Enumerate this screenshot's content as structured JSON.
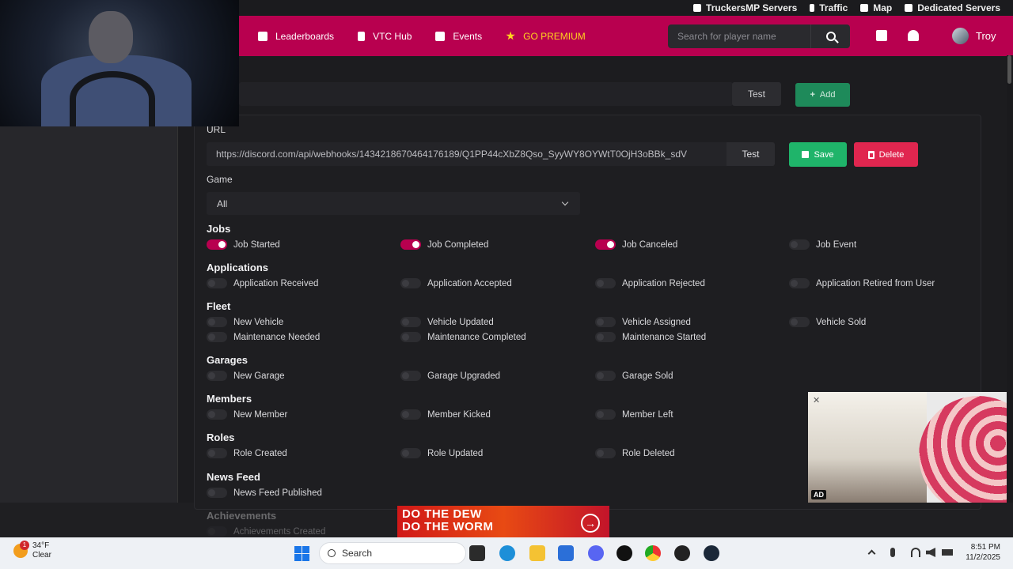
{
  "topbar": {
    "links": [
      "TruckersMP Servers",
      "Traffic",
      "Map",
      "Dedicated Servers"
    ]
  },
  "nav": {
    "items": [
      "Leaderboards",
      "VTC Hub",
      "Events",
      "GO PREMIUM"
    ],
    "search_placeholder": "Search for player name",
    "user": "Troy"
  },
  "buttons": {
    "test": "Test",
    "add": "Add",
    "save": "Save",
    "delete": "Delete"
  },
  "form": {
    "url_label": "URL",
    "url_value": "https://discord.com/api/webhooks/1434218670464176189/Q1PP44cXbZ8Qso_SyyWY8OYWtT0OjH3oBBk_sdV",
    "game_label": "Game",
    "game_value": "All"
  },
  "sections": [
    {
      "title": "Jobs",
      "items": [
        {
          "label": "Job Started",
          "on": true
        },
        {
          "label": "Job Completed",
          "on": true
        },
        {
          "label": "Job Canceled",
          "on": true
        },
        {
          "label": "Job Event",
          "on": false
        }
      ]
    },
    {
      "title": "Applications",
      "items": [
        {
          "label": "Application Received",
          "on": false
        },
        {
          "label": "Application Accepted",
          "on": false
        },
        {
          "label": "Application Rejected",
          "on": false
        },
        {
          "label": "Application Retired from User",
          "on": false
        }
      ]
    },
    {
      "title": "Fleet",
      "items": [
        {
          "label": "New Vehicle",
          "on": false
        },
        {
          "label": "Vehicle Updated",
          "on": false
        },
        {
          "label": "Vehicle Assigned",
          "on": false
        },
        {
          "label": "Vehicle Sold",
          "on": false
        },
        {
          "label": "Maintenance Needed",
          "on": false
        },
        {
          "label": "Maintenance Completed",
          "on": false
        },
        {
          "label": "Maintenance Started",
          "on": false
        }
      ]
    },
    {
      "title": "Garages",
      "items": [
        {
          "label": "New Garage",
          "on": false
        },
        {
          "label": "Garage Upgraded",
          "on": false
        },
        {
          "label": "Garage Sold",
          "on": false
        }
      ]
    },
    {
      "title": "Members",
      "items": [
        {
          "label": "New Member",
          "on": false
        },
        {
          "label": "Member Kicked",
          "on": false
        },
        {
          "label": "Member Left",
          "on": false
        }
      ]
    },
    {
      "title": "Roles",
      "items": [
        {
          "label": "Role Created",
          "on": false
        },
        {
          "label": "Role Updated",
          "on": false
        },
        {
          "label": "Role Deleted",
          "on": false
        }
      ]
    },
    {
      "title": "News Feed",
      "items": [
        {
          "label": "News Feed Published",
          "on": false
        }
      ]
    },
    {
      "title": "Achievements",
      "items": [
        {
          "label": "Achievements Created",
          "on": false
        }
      ]
    }
  ],
  "ad": {
    "text_line1": "DO THE DEW",
    "text_line2": "DO THE WORM"
  },
  "video_ad": {
    "badge": "AD"
  },
  "taskbar": {
    "temp": "34°F",
    "weather": "Clear",
    "weather_badge": "1",
    "search": "Search",
    "time": "8:51 PM",
    "date": "11/2/2025"
  },
  "colors": {
    "accent": "#b8004f",
    "save": "#1fb46a",
    "delete": "#e0264f",
    "add": "#1e8a5a",
    "premium": "#ffd21f"
  }
}
